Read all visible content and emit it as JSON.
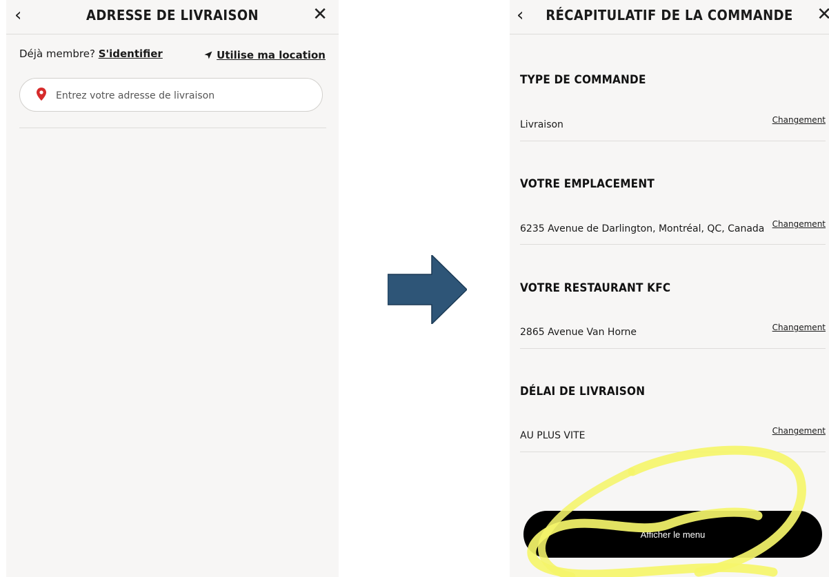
{
  "left_screen": {
    "header": {
      "title": "ADRESSE DE LIVRAISON",
      "back_icon": "chevron-left-icon",
      "close_icon": "close-icon"
    },
    "member_prompt": "Déjà membre?",
    "signin_link": "S'identifier",
    "use_location": {
      "label": "Utilise ma location",
      "icon": "navigation-arrow-icon"
    },
    "address_input": {
      "placeholder": "Entrez votre adresse de livraison",
      "value": "",
      "icon": "map-pin-icon",
      "icon_color": "#d62b2b"
    }
  },
  "transition_arrow": {
    "icon": "right-arrow-icon",
    "color": "#2e5577"
  },
  "right_screen": {
    "header": {
      "title": "RÉCAPITULATIF DE LA COMMANDE",
      "back_icon": "chevron-left-icon",
      "close_icon": "close-icon"
    },
    "sections": [
      {
        "heading": "TYPE DE COMMANDE",
        "value": "Livraison",
        "action": "Changement"
      },
      {
        "heading": "VOTRE EMPLACEMENT",
        "value": "6235 Avenue de Darlington, Montréal, QC, Canada",
        "action": "Changement"
      },
      {
        "heading": "VOTRE RESTAURANT KFC",
        "value": "2865 Avenue Van Horne",
        "action": "Changement"
      },
      {
        "heading": "DÉLAI DE LIVRAISON",
        "value": "AU PLUS VITE",
        "action": "Changement"
      }
    ],
    "primary_button": {
      "label": "Afficher le menu",
      "color": "#000000"
    },
    "highlight": {
      "color": "#f5f56a"
    }
  }
}
